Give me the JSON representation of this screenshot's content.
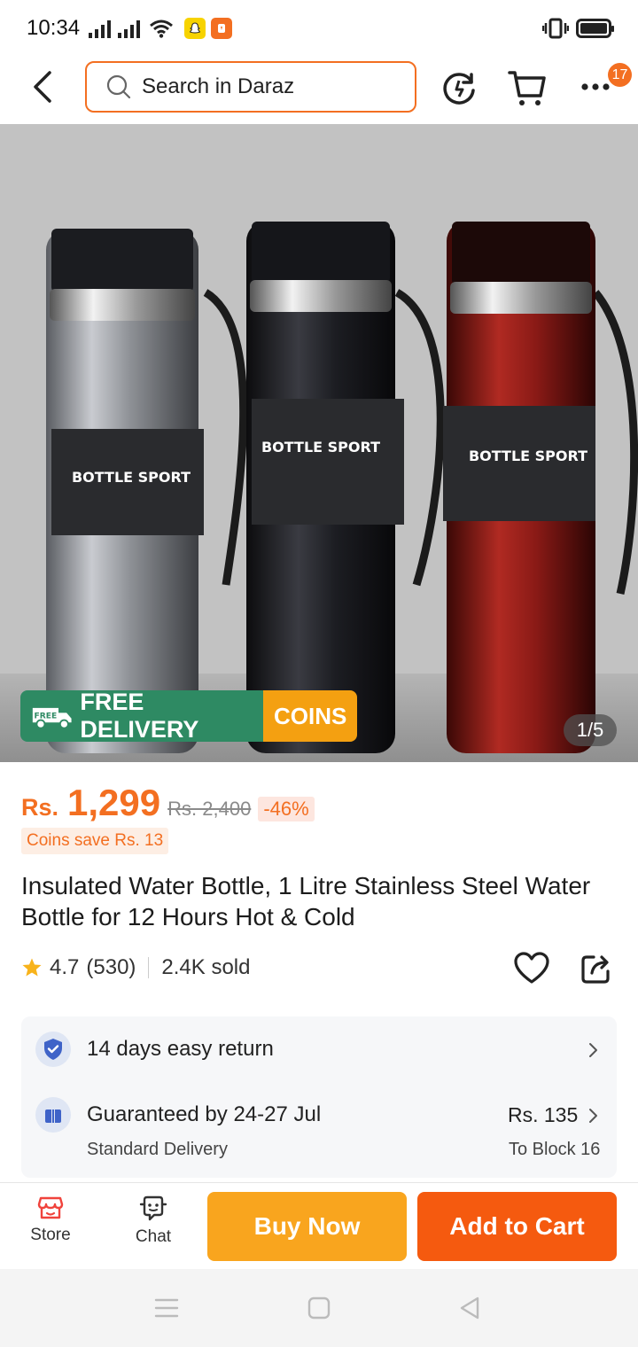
{
  "status_bar": {
    "time": "10:34",
    "icons": [
      "signal-icon",
      "signal-icon",
      "wifi-icon",
      "snapchat-icon",
      "app-notification-icon",
      "vibrate-icon",
      "battery-icon"
    ]
  },
  "header": {
    "search_placeholder": "Search in Daraz",
    "notification_count": "17",
    "icons": [
      "back-arrow-icon",
      "search-icon",
      "history-icon",
      "cart-icon",
      "more-icon"
    ]
  },
  "product_image": {
    "product_name_on_label": "BOTTLE SPORT",
    "promo": {
      "free_tag": "FREE",
      "free_delivery": "FREE DELIVERY",
      "coins": "COINS"
    },
    "counter": "1/5",
    "bottle_colors": [
      "#8e9196",
      "#1c1d22",
      "#8a1a16"
    ]
  },
  "price": {
    "currency": "Rs.",
    "value": "1,299",
    "original": "Rs. 2,400",
    "discount": "-46%",
    "coins_save": "Coins save Rs. 13"
  },
  "product": {
    "title": "Insulated Water Bottle, 1 Litre Stainless Steel Water Bottle for 12 Hours Hot & Cold",
    "rating": "4.7",
    "reviews": "(530)",
    "sold": "2.4K sold"
  },
  "services": {
    "return_policy": "14 days easy return",
    "delivery_guarantee": "Guaranteed by 24-27 Jul",
    "delivery_type": "Standard Delivery",
    "delivery_price": "Rs. 135",
    "delivery_location": "To Block 16"
  },
  "bottom_bar": {
    "store_label": "Store",
    "chat_label": "Chat",
    "buy_now": "Buy Now",
    "add_to_cart": "Add to Cart"
  },
  "colors": {
    "accent": "#f36f21",
    "buy_now": "#f9a51e",
    "add_to_cart": "#f55a0f",
    "free_delivery": "#2e8a63",
    "coins": "#f4a011"
  }
}
